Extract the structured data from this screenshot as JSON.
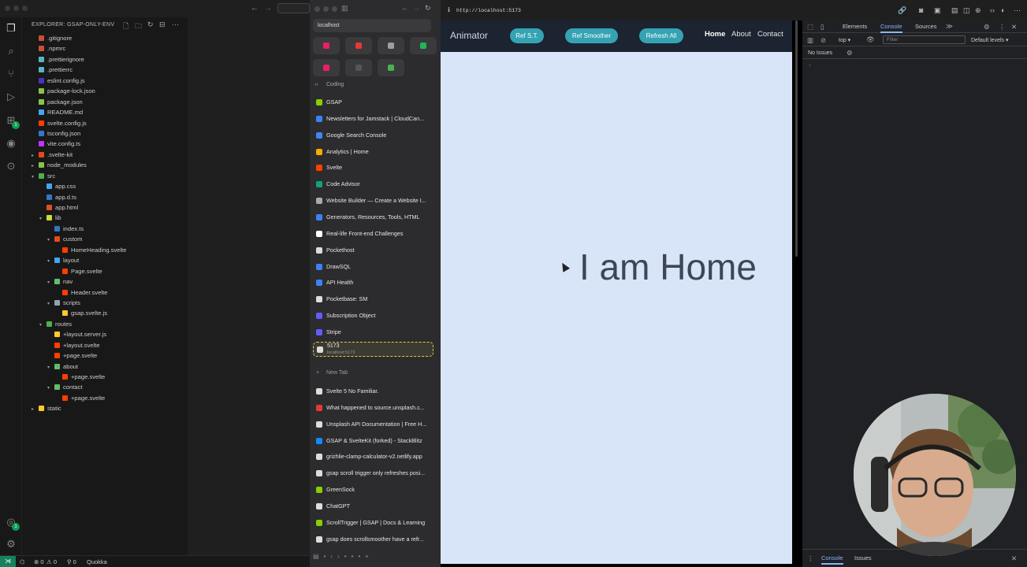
{
  "vscode": {
    "explorer_title": "EXPLORER: GSAP-ONLY-ENV",
    "tree": [
      {
        "label": ".gitignore",
        "depth": 0,
        "type": "file",
        "color": "#c94f3a"
      },
      {
        "label": ".npmrc",
        "depth": 0,
        "type": "file",
        "color": "#c94f3a"
      },
      {
        "label": ".prettierignore",
        "depth": 0,
        "type": "file",
        "color": "#56b6c2"
      },
      {
        "label": ".prettierrc",
        "depth": 0,
        "type": "file",
        "color": "#56b6c2"
      },
      {
        "label": "eslint.config.js",
        "depth": 0,
        "type": "file",
        "color": "#4b32c3"
      },
      {
        "label": "package-lock.json",
        "depth": 0,
        "type": "file",
        "color": "#8bc34a"
      },
      {
        "label": "package.json",
        "depth": 0,
        "type": "file",
        "color": "#8bc34a"
      },
      {
        "label": "README.md",
        "depth": 0,
        "type": "file",
        "color": "#42a5f5"
      },
      {
        "label": "svelte.config.js",
        "depth": 0,
        "type": "file",
        "color": "#ff3e00"
      },
      {
        "label": "tsconfig.json",
        "depth": 0,
        "type": "file",
        "color": "#3178c6"
      },
      {
        "label": "vite.config.ts",
        "depth": 0,
        "type": "file",
        "color": "#bd34fe"
      },
      {
        "label": ".svelte-kit",
        "depth": 0,
        "type": "folder",
        "open": false,
        "color": "#e64a19"
      },
      {
        "label": "node_modules",
        "depth": 0,
        "type": "folder",
        "open": false,
        "color": "#8bc34a"
      },
      {
        "label": "src",
        "depth": 0,
        "type": "folder",
        "open": true,
        "color": "#4caf50"
      },
      {
        "label": "app.css",
        "depth": 1,
        "type": "file",
        "color": "#42a5f5"
      },
      {
        "label": "app.d.ts",
        "depth": 1,
        "type": "file",
        "color": "#3178c6"
      },
      {
        "label": "app.html",
        "depth": 1,
        "type": "file",
        "color": "#e44d26"
      },
      {
        "label": "lib",
        "depth": 1,
        "type": "folder",
        "open": true,
        "color": "#cddc39"
      },
      {
        "label": "index.ts",
        "depth": 2,
        "type": "file",
        "color": "#3178c6"
      },
      {
        "label": "custom",
        "depth": 2,
        "type": "folder",
        "open": true,
        "color": "#e64a19"
      },
      {
        "label": "HomeHeading.svelte",
        "depth": 3,
        "type": "file",
        "color": "#ff3e00"
      },
      {
        "label": "layout",
        "depth": 2,
        "type": "folder",
        "open": true,
        "color": "#42a5f5"
      },
      {
        "label": "Page.svelte",
        "depth": 3,
        "type": "file",
        "color": "#ff3e00"
      },
      {
        "label": "nav",
        "depth": 2,
        "type": "folder",
        "open": true,
        "color": "#66bb6a"
      },
      {
        "label": "Header.svelte",
        "depth": 3,
        "type": "file",
        "color": "#ff3e00"
      },
      {
        "label": "scripts",
        "depth": 2,
        "type": "folder",
        "open": true,
        "color": "#90a4ae"
      },
      {
        "label": "gsap.svelte.js",
        "depth": 3,
        "type": "file",
        "color": "#ffca28"
      },
      {
        "label": "routes",
        "depth": 1,
        "type": "folder",
        "open": true,
        "color": "#4caf50"
      },
      {
        "label": "+layout.server.js",
        "depth": 2,
        "type": "file",
        "color": "#ffca28"
      },
      {
        "label": "+layout.svelte",
        "depth": 2,
        "type": "file",
        "color": "#ff3e00"
      },
      {
        "label": "+page.svelte",
        "depth": 2,
        "type": "file",
        "color": "#ff3e00"
      },
      {
        "label": "about",
        "depth": 2,
        "type": "folder",
        "open": true,
        "color": "#66bb6a"
      },
      {
        "label": "+page.svelte",
        "depth": 3,
        "type": "file",
        "color": "#ff3e00"
      },
      {
        "label": "contact",
        "depth": 2,
        "type": "folder",
        "open": true,
        "color": "#66bb6a"
      },
      {
        "label": "+page.svelte",
        "depth": 3,
        "type": "file",
        "color": "#ff3e00"
      },
      {
        "label": "static",
        "depth": 0,
        "type": "folder",
        "open": false,
        "color": "#ffca28"
      }
    ],
    "status": {
      "errors": "0",
      "warnings": "0",
      "ports": "0",
      "extension": "Quokka"
    },
    "badge_count": "1"
  },
  "arc": {
    "url": "localhost",
    "favorite_colors": [
      "#e91e63",
      "#e53935",
      "#9e9e9e",
      "#1db954",
      "#e91e63",
      "#555555",
      "#4caf50"
    ],
    "section": "Coding",
    "tabs": [
      {
        "label": "GSAP",
        "color": "#88ce02"
      },
      {
        "label": "Newsletters for Jamstack | CloudCan...",
        "color": "#3b82f6"
      },
      {
        "label": "Google Search Console",
        "color": "#4285f4"
      },
      {
        "label": "Analytics | Home",
        "color": "#f9ab00"
      },
      {
        "label": "Svelte",
        "color": "#ff3e00"
      },
      {
        "label": "Code Advisor",
        "color": "#10a37f"
      },
      {
        "label": "Website Builder — Create a Website I...",
        "color": "#aaaaaa"
      },
      {
        "label": "Generators, Resources, Tools, HTML",
        "color": "#3b82f6"
      },
      {
        "label": "Real-life Front-end Challenges",
        "color": "#ffffff"
      },
      {
        "label": "Pockethost",
        "color": "#dddddd"
      },
      {
        "label": "DrawSQL",
        "color": "#3b82f6"
      },
      {
        "label": "API Health",
        "color": "#3b82f6"
      },
      {
        "label": "Pocketbase: SM",
        "color": "#dddddd"
      },
      {
        "label": "Subscription Object",
        "color": "#635bff"
      },
      {
        "label": "Stripe",
        "color": "#635bff"
      }
    ],
    "dragging_tab": {
      "title": "5173",
      "subtitle": "localhost:5173"
    },
    "new_tab": "New Tab",
    "tabs_below": [
      {
        "label": "Svelte 5 No Familiar.",
        "color": "#dddddd"
      },
      {
        "label": "What happened to source.unsplash.c...",
        "color": "#e53935"
      },
      {
        "label": "Unsplash API Documentation | Free H...",
        "color": "#dddddd"
      },
      {
        "label": "GSAP & SvelteKit (forked) - StackBlitz",
        "color": "#1389fd"
      },
      {
        "label": "grizhlie-clamp-calculator-v2.netlify.app",
        "color": "#dddddd"
      },
      {
        "label": "gsap scroll trigger only refreshes posi...",
        "color": "#dddddd"
      },
      {
        "label": "GreenSock",
        "color": "#88ce02"
      },
      {
        "label": "ChatGPT",
        "color": "#dddddd"
      },
      {
        "label": "ScrollTrigger | GSAP | Docs & Learning",
        "color": "#88ce02"
      },
      {
        "label": "gsap does scrollsmoother have a refr...",
        "color": "#dddddd"
      }
    ]
  },
  "browser": {
    "address": "http://localhost:5173"
  },
  "app": {
    "brand": "Animator",
    "buttons": [
      "Ref S.T.",
      "Ref Smoother",
      "Refresh All"
    ],
    "nav": [
      "Home",
      "About",
      "Contact"
    ],
    "heading": "I am Home",
    "colors": {
      "navbar": "#1b2430",
      "pill": "#35a3b3",
      "page_bg": "#d8e5f8"
    }
  },
  "devtools": {
    "tabs": [
      "Elements",
      "Console",
      "Sources"
    ],
    "active_tab": "Console",
    "context": "top",
    "filter_placeholder": "Filter",
    "levels": "Default levels",
    "issues": "No Issues",
    "drawer_tabs": [
      "Console",
      "Issues"
    ]
  }
}
